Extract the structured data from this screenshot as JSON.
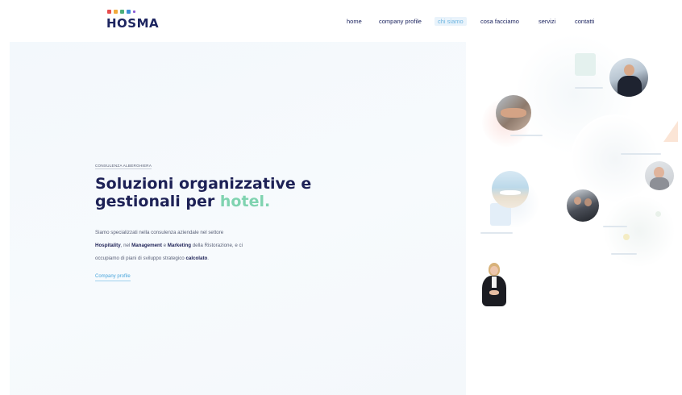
{
  "brand": {
    "logo_text": "HOSMA",
    "dot_colors": [
      "#e84d4d",
      "#f2a93b",
      "#4caf7a",
      "#3f8fd8",
      "#8a5bd6"
    ]
  },
  "nav": {
    "items": [
      {
        "label": "home",
        "active": false
      },
      {
        "label": "company profile",
        "active": false
      },
      {
        "label": "chi siamo",
        "active": true
      },
      {
        "label": "cosa facciamo",
        "active": false
      },
      {
        "label": "servizi",
        "active": false
      },
      {
        "label": "contatti",
        "active": false
      }
    ]
  },
  "hero": {
    "eyebrow": "CONSULENZA ALBERGHIERA",
    "headline_part1": "Soluzioni organizzative e",
    "headline_part2": "gestionali per ",
    "headline_highlight": "hotel.",
    "desc_line1": "Siamo specializzati nella consulenza aziendale nel settore",
    "desc_line2_b1": "Hospitality",
    "desc_line2_mid": ", nel ",
    "desc_line2_b2": "Management",
    "desc_line2_mid2": " e ",
    "desc_line2_b3": "Marketing",
    "desc_line2_end": " della Ristorazione, e ci",
    "desc_line3": "occupiamo di piani di sviluppo strategico ",
    "desc_line3_b": "calcolato",
    "desc_line3_end": ".",
    "cta_label": "Company profile"
  },
  "colors": {
    "navy": "#1d2156",
    "accent_green": "#7fd3b0",
    "accent_blue": "#4aa6dc"
  }
}
